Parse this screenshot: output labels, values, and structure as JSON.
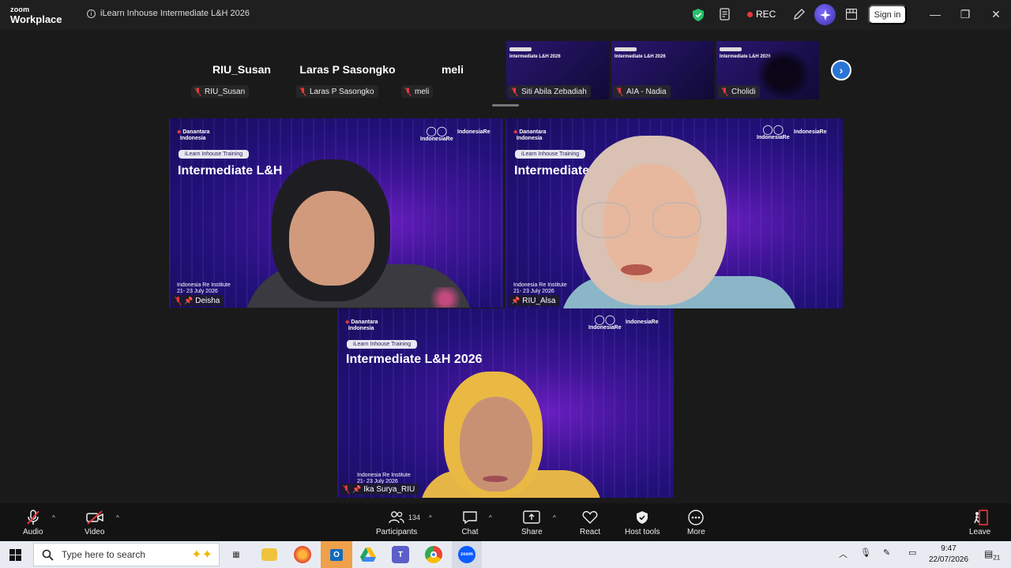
{
  "titlebar": {
    "logo_line1": "zoom",
    "logo_line2": "Workplace",
    "meeting_title": "iLearn Inhouse Intermediate L&H 2026",
    "rec_label": "REC",
    "signin_label": "Sign in",
    "colors": {
      "shield": "#27c26a",
      "rec_dot": "#e5393d",
      "ai": "#5a4de0"
    }
  },
  "strip": {
    "names": [
      {
        "large": "RIU_Susan",
        "tag": "RIU_Susan"
      },
      {
        "large": "Laras P Sasongko",
        "tag": "Laras P Sasongko"
      },
      {
        "large": "meli",
        "tag": "meli"
      }
    ],
    "thumbs": [
      {
        "slide_title": "Intermediate L&H 2026",
        "tag": "Siti Abila Zebadiah"
      },
      {
        "slide_title": "Intermediate L&H 2026",
        "tag": "AIA - Nadia"
      },
      {
        "slide_title": "Intermediate L&H 2026",
        "tag": "Cholidi"
      }
    ]
  },
  "slide": {
    "brand_left_1": "Danantara",
    "brand_left_2": "Indonesia",
    "brand_right_1": "IndonesiaRe",
    "brand_right_2": "IndonesiaRe",
    "pill": "iLearn Inhouse Training",
    "title_full": "Intermediate L&H 2026",
    "title_cut_1": "Intermediate L&H",
    "title_cut_2": "Intermediate",
    "foot_1": "Indonesia Re Institute",
    "foot_2": "21- 23 July 2026"
  },
  "tiles": [
    {
      "name": "Deisha"
    },
    {
      "name": "RIU_Alsa"
    },
    {
      "name": "Ika Surya_RIU"
    }
  ],
  "toolbar": {
    "audio": "Audio",
    "video": "Video",
    "participants": "Participants",
    "participant_count": "134",
    "chat": "Chat",
    "share": "Share",
    "react": "React",
    "host_tools": "Host tools",
    "more": "More",
    "leave": "Leave"
  },
  "taskbar": {
    "search_placeholder": "Type here to search",
    "time": "9:47",
    "date": "22/07/2026",
    "notifications": "21"
  }
}
